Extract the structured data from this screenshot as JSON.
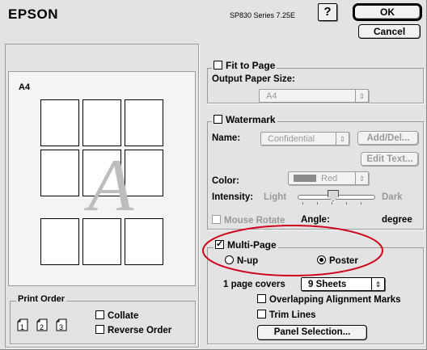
{
  "header": {
    "brand": "EPSON",
    "version": "SP830 Series 7.25E",
    "help_label": "?",
    "ok_label": "OK",
    "cancel_label": "Cancel"
  },
  "preview": {
    "paper_label": "A4",
    "sheet_count": 9,
    "watermark_glyph": "A"
  },
  "print_order": {
    "title": "Print Order",
    "collate_label": "Collate",
    "collate_checked": false,
    "reverse_label": "Reverse Order",
    "reverse_checked": false,
    "icons": [
      "order-1-icon",
      "order-2-icon",
      "order-3-icon"
    ],
    "icon_numbers": [
      "1",
      "2",
      "3"
    ]
  },
  "fit_to_page": {
    "label": "Fit to Page",
    "checked": false,
    "output_size_label": "Output Paper Size:",
    "output_size_value": "A4"
  },
  "watermark": {
    "label": "Watermark",
    "checked": false,
    "name_label": "Name:",
    "name_value": "Confidential",
    "add_del_label": "Add/Del...",
    "edit_text_label": "Edit Text...",
    "color_label": "Color:",
    "color_value": "Red",
    "color_swatch": "#8c8c8c",
    "intensity_label": "Intensity:",
    "intensity_light": "Light",
    "intensity_dark": "Dark",
    "intensity_level": 0.45,
    "mouse_rotate_label": "Mouse Rotate",
    "angle_label": "Angle:",
    "angle_unit": "degree"
  },
  "multi_page": {
    "label": "Multi-Page",
    "checked": true,
    "nup_label": "N-up",
    "poster_label": "Poster",
    "selected": "Poster",
    "covers_label": "1 page covers",
    "covers_value": "9 Sheets",
    "overlap_label": "Overlapping Alignment Marks",
    "overlap_checked": false,
    "trim_label": "Trim Lines",
    "trim_checked": false,
    "panel_selection_label": "Panel Selection..."
  },
  "colors": {
    "highlight_ring": "#d0021b",
    "window_bg": "#e3e3e3"
  }
}
